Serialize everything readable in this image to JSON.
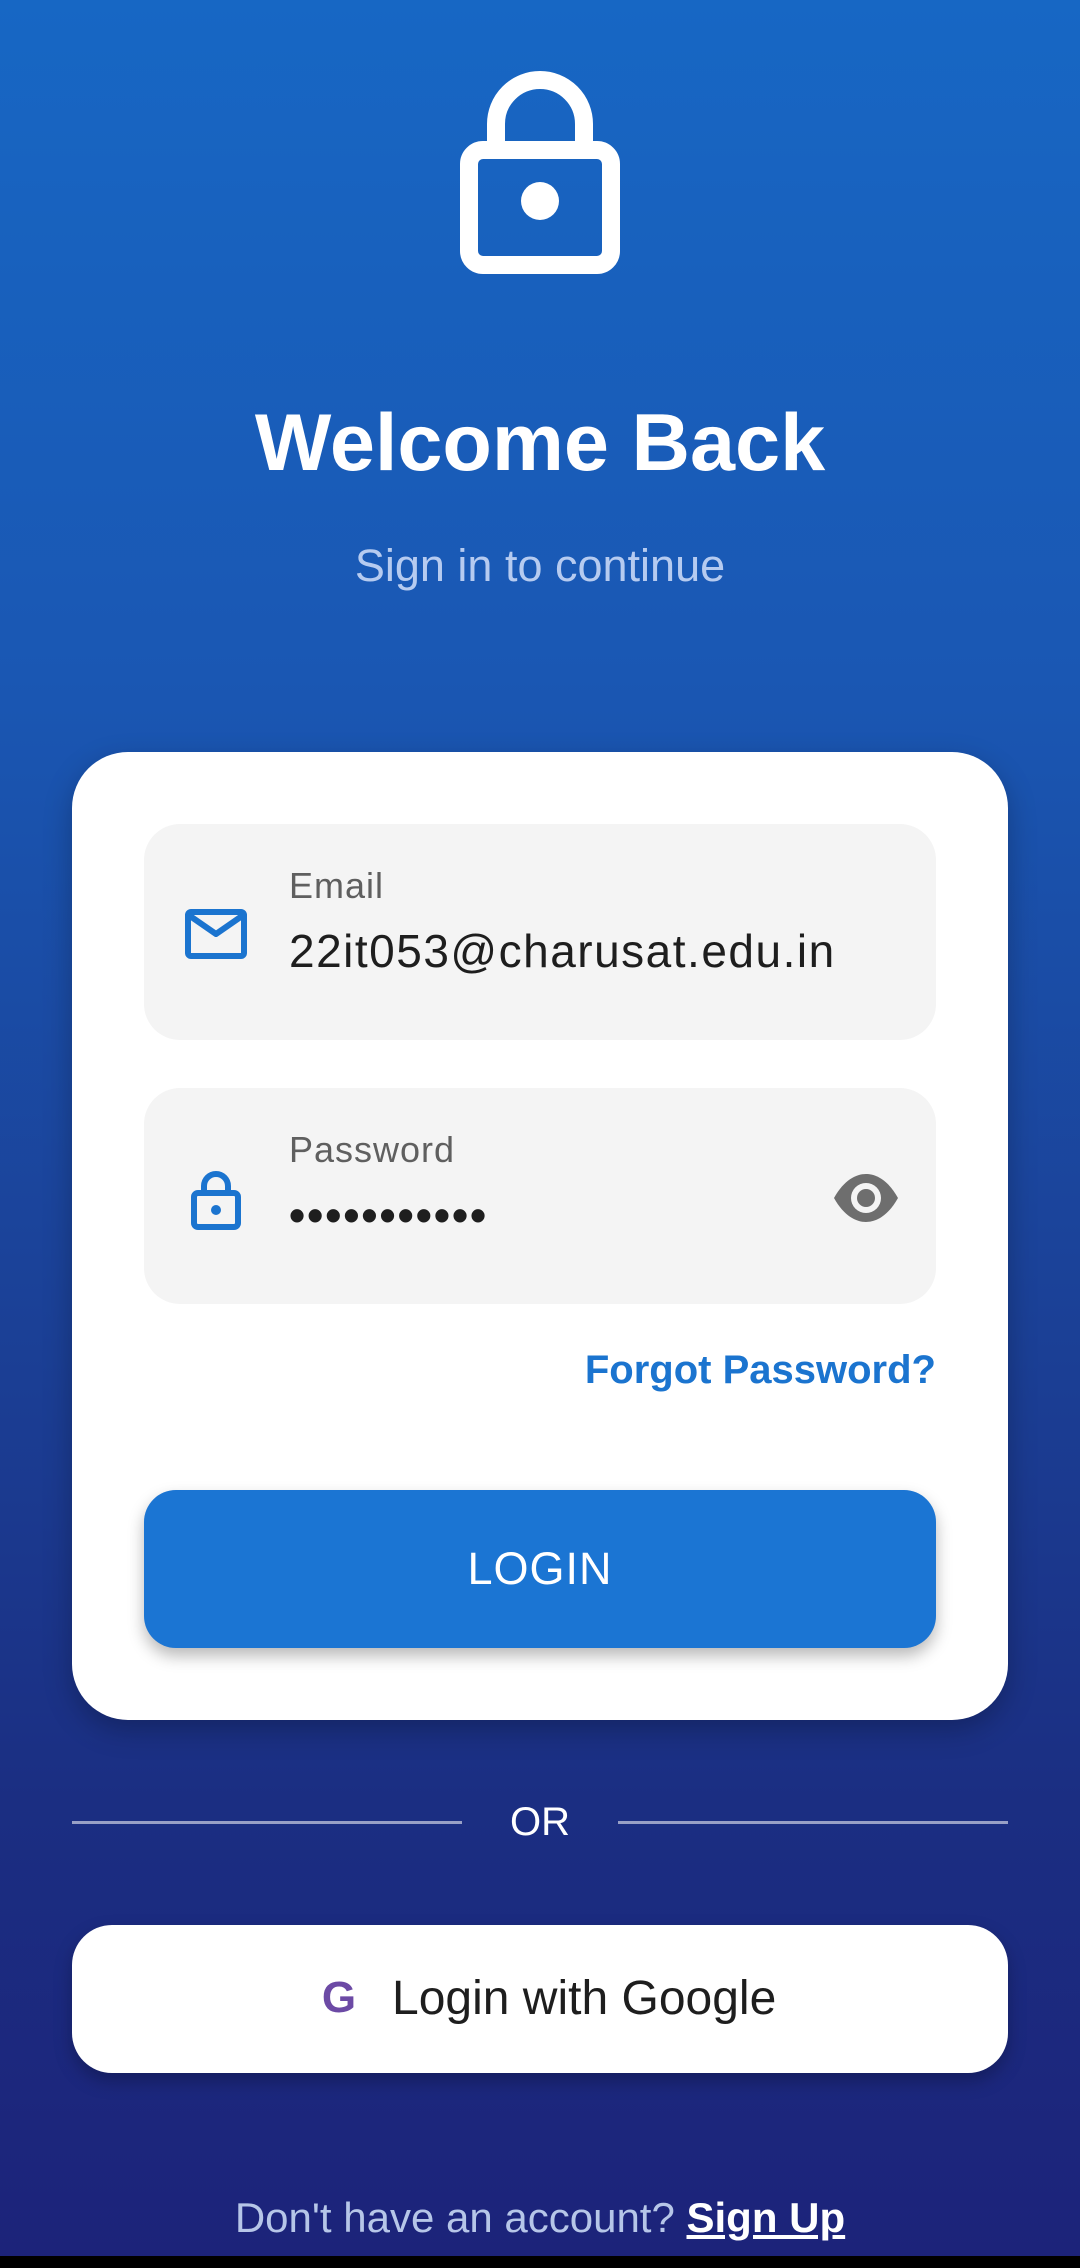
{
  "header": {
    "icon": "lock-icon",
    "title": "Welcome Back",
    "subtitle": "Sign in to continue"
  },
  "form": {
    "email": {
      "icon": "mail-icon",
      "label": "Email",
      "value": "22it053@charusat.edu.in"
    },
    "password": {
      "icon": "lock-icon",
      "label": "Password",
      "value": "•••••••••••",
      "visibility_icon": "eye-icon"
    },
    "forgot_password": "Forgot Password?",
    "login_button": "LOGIN"
  },
  "divider": {
    "label": "OR"
  },
  "google": {
    "icon": "google-icon",
    "label": "Login with Google"
  },
  "signup": {
    "prompt": "Don't have an account?",
    "link": "Sign Up"
  },
  "colors": {
    "background_top": "#1767c4",
    "background_bottom": "#1c237a",
    "accent": "#1b75d3",
    "link": "#1b74cf"
  }
}
